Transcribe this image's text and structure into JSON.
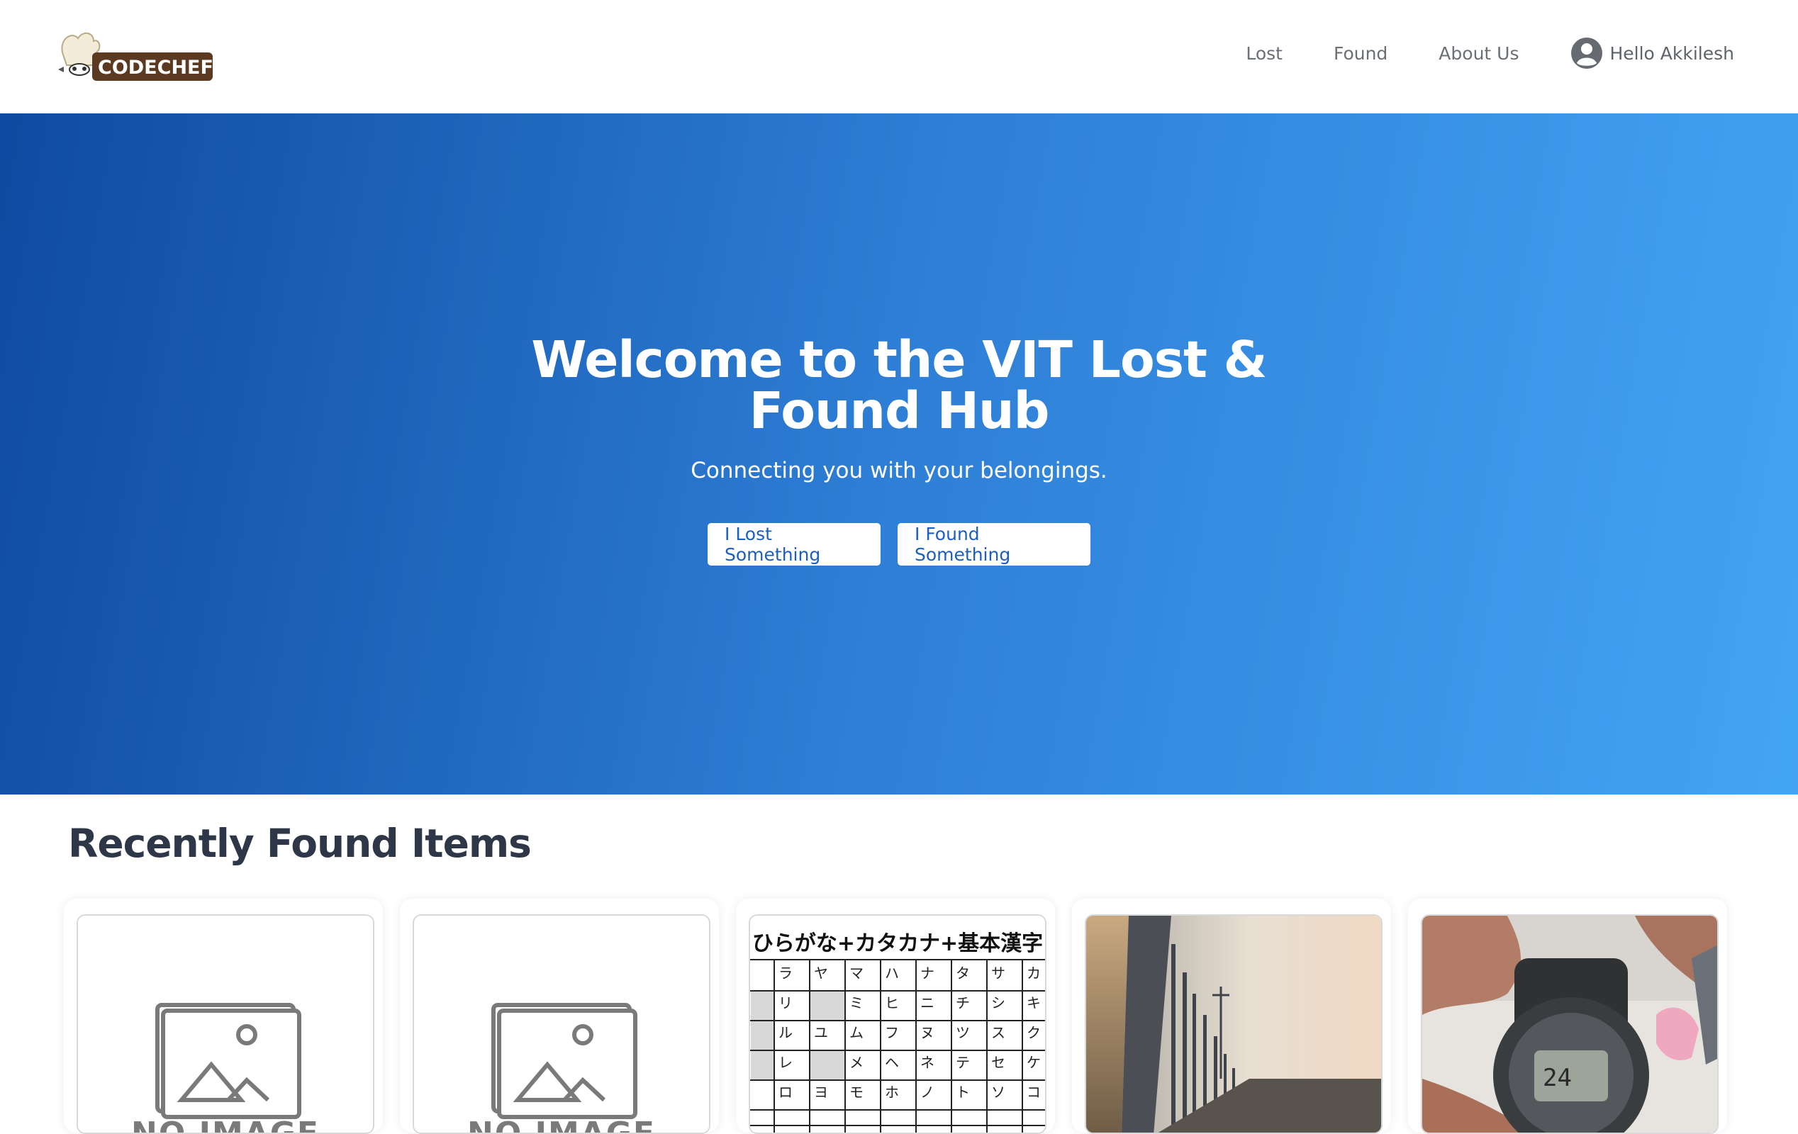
{
  "navbar": {
    "logo_text": "CODECHEF",
    "links": [
      {
        "label": "Lost"
      },
      {
        "label": "Found"
      },
      {
        "label": "About Us"
      }
    ],
    "user_greeting": "Hello Akkilesh",
    "avatar_icon": "user-circle-icon"
  },
  "hero": {
    "title_line1": "Welcome to the VIT Lost &",
    "title_line2": "Found Hub",
    "subtitle": "Connecting you with your belongings.",
    "lost_button": "I Lost Something",
    "found_button": "I Found Something",
    "gradient_start": "#0f4aa1",
    "gradient_end": "#43a5f4"
  },
  "recent": {
    "title": "Recently Found Items",
    "items": [
      {
        "image": "no-image-placeholder",
        "placeholder_text": "NO IMAGE"
      },
      {
        "image": "no-image-placeholder",
        "placeholder_text": "NO IMAGE"
      },
      {
        "image": "kana-chart-photo",
        "caption_in_image": "ひらがな+カタカナ+基本漢字"
      },
      {
        "image": "lakeside-sunset-photo"
      },
      {
        "image": "wristwatch-photo"
      }
    ]
  }
}
